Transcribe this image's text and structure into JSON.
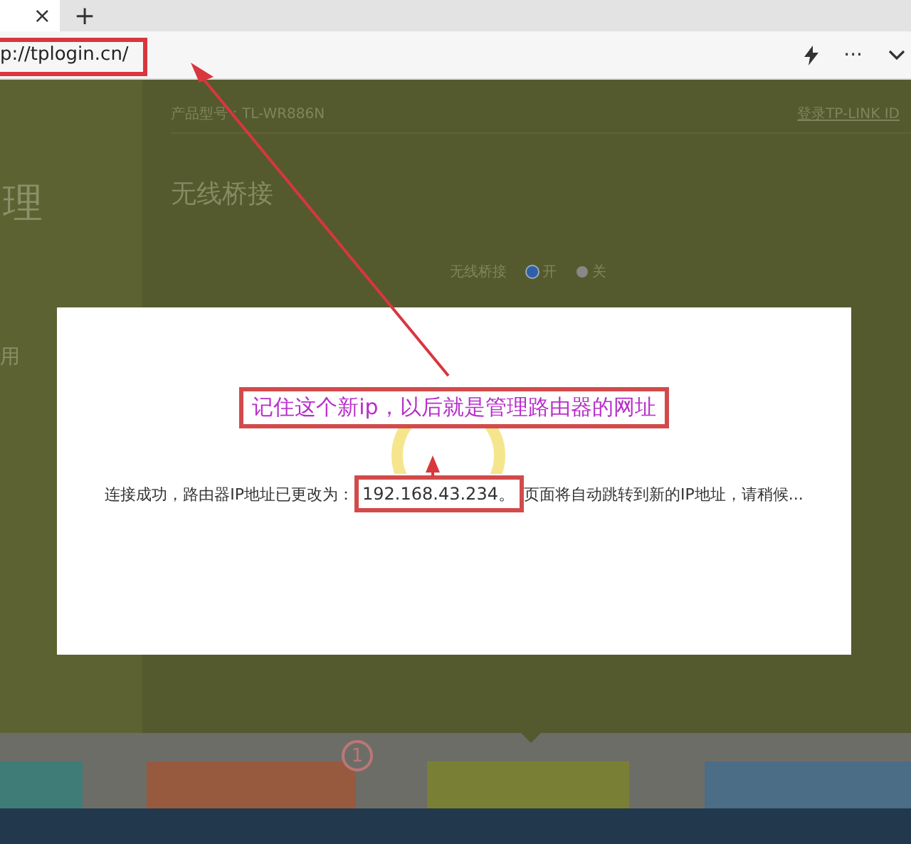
{
  "browser": {
    "tab_close": "×",
    "new_tab": "+",
    "url": "p://tplogin.cn/",
    "more": "···"
  },
  "header": {
    "model": "产品型号：TL-WR886N",
    "login": "登录TP-LINK ID"
  },
  "sidebar": {
    "title": "理",
    "item": "用"
  },
  "section_title": "无线桥接",
  "bridge_toggle": {
    "label": "无线桥接",
    "options": [
      {
        "label": "开",
        "selected": true
      },
      {
        "label": "关",
        "selected": false
      }
    ]
  },
  "modal": {
    "callout": "记住这个新ip，以后就是管理路由器的网址",
    "message_before": "连接成功，路由器IP地址已更改为：",
    "ip": "192.168.43.234。",
    "message_after": "页面将自动跳转到新的IP地址，请稍候..."
  },
  "tiles": [
    {
      "color": "#3f7c78"
    },
    {
      "color": "#975a3e",
      "badge": "1"
    },
    {
      "color": "#7a7f36"
    },
    {
      "color": "#4b6d86"
    }
  ]
}
